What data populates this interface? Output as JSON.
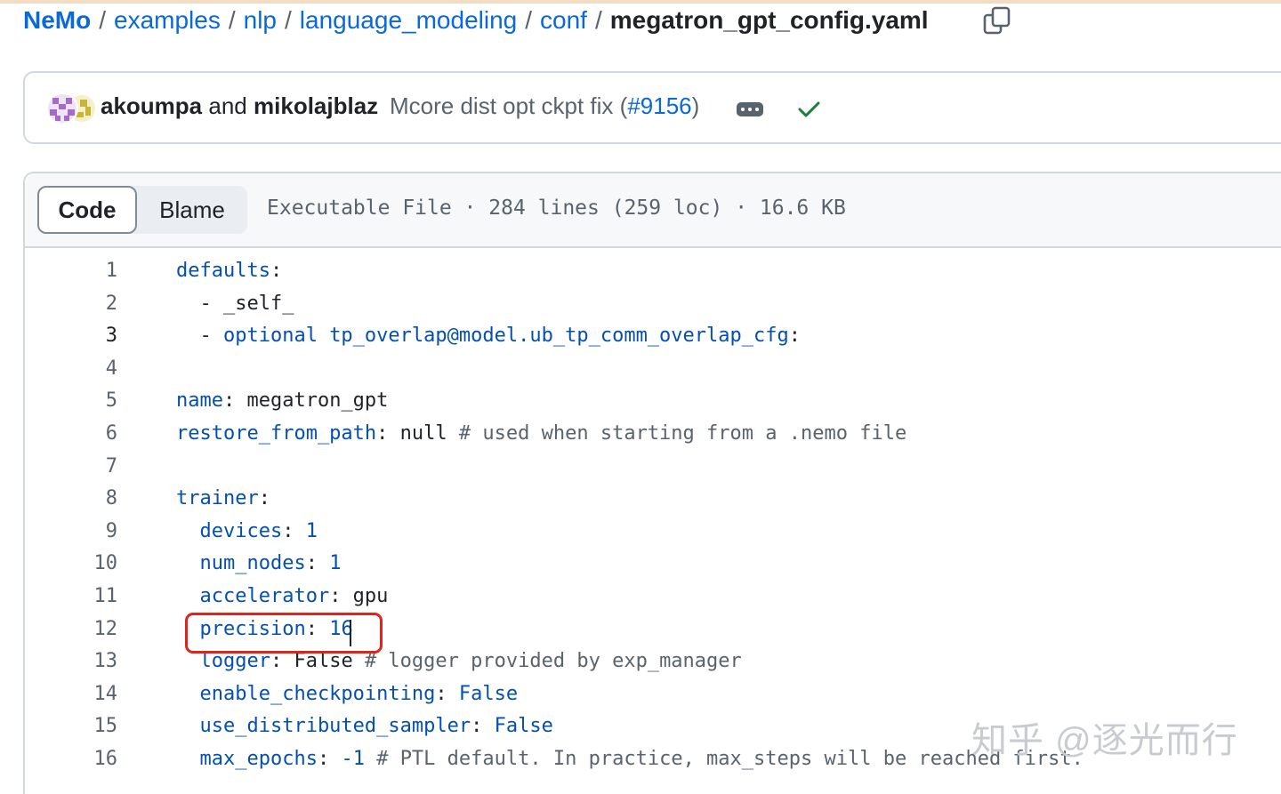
{
  "breadcrumb": {
    "root": "NeMo",
    "parts": [
      "examples",
      "nlp",
      "language_modeling",
      "conf"
    ],
    "separator": "/",
    "file": "megatron_gpt_config.yaml"
  },
  "icons": {
    "copy": "copy-icon",
    "avatars": "avatar-stack-icon",
    "more": "ellipsis-icon",
    "status": "check-icon"
  },
  "commit": {
    "author1": "akoumpa",
    "and": "and",
    "author2": "mikolajblaz",
    "message_prefix": "Mcore dist opt ckpt fix (",
    "pr": "#9156",
    "message_suffix": ")",
    "status_color": "#1a7f37"
  },
  "file_header": {
    "tab_code": "Code",
    "tab_blame": "Blame",
    "meta": "Executable File · 284 lines (259 loc) · 16.6 KB"
  },
  "code_lines": [
    {
      "n": "1",
      "key": "defaults",
      "rest": ":",
      "comment": ""
    },
    {
      "n": "2",
      "key": "",
      "rest": "  - _self_",
      "comment": ""
    },
    {
      "n": "3",
      "key": "",
      "rest": "  - ",
      "kw": "optional tp_overlap@model.ub_tp_comm_overlap_cfg",
      "tail": ":",
      "comment": ""
    },
    {
      "n": "4",
      "key": "",
      "rest": "",
      "comment": ""
    },
    {
      "n": "5",
      "key": "name",
      "rest": ": megatron_gpt",
      "comment": ""
    },
    {
      "n": "6",
      "key": "restore_from_path",
      "rest": ": null ",
      "comment": "# used when starting from a .nemo file"
    },
    {
      "n": "7",
      "key": "",
      "rest": "",
      "comment": ""
    },
    {
      "n": "8",
      "key": "trainer",
      "rest": ":",
      "comment": ""
    },
    {
      "n": "9",
      "key": "  devices",
      "rest": ": ",
      "val": "1",
      "comment": ""
    },
    {
      "n": "10",
      "key": "  num_nodes",
      "rest": ": ",
      "val": "1",
      "comment": ""
    },
    {
      "n": "11",
      "key": "  accelerator",
      "rest": ": gpu",
      "comment": ""
    },
    {
      "n": "12",
      "key": "  precision",
      "rest": ": ",
      "val": "16",
      "comment": ""
    },
    {
      "n": "13",
      "key": "  logger",
      "rest": ": False ",
      "comment": "# logger provided by exp_manager"
    },
    {
      "n": "14",
      "key": "  enable_checkpointing",
      "rest": ": ",
      "val": "False",
      "comment": ""
    },
    {
      "n": "15",
      "key": "  use_distributed_sampler",
      "rest": ": ",
      "val": "False",
      "comment": ""
    },
    {
      "n": "16",
      "key": "  max_epochs",
      "rest": ": ",
      "val": "-1",
      "comment": " # PTL default. In practice, max_steps will be reached first."
    }
  ],
  "active_line": "3",
  "highlight_color": "#e0241b",
  "watermark": "知乎 @逐光而行"
}
